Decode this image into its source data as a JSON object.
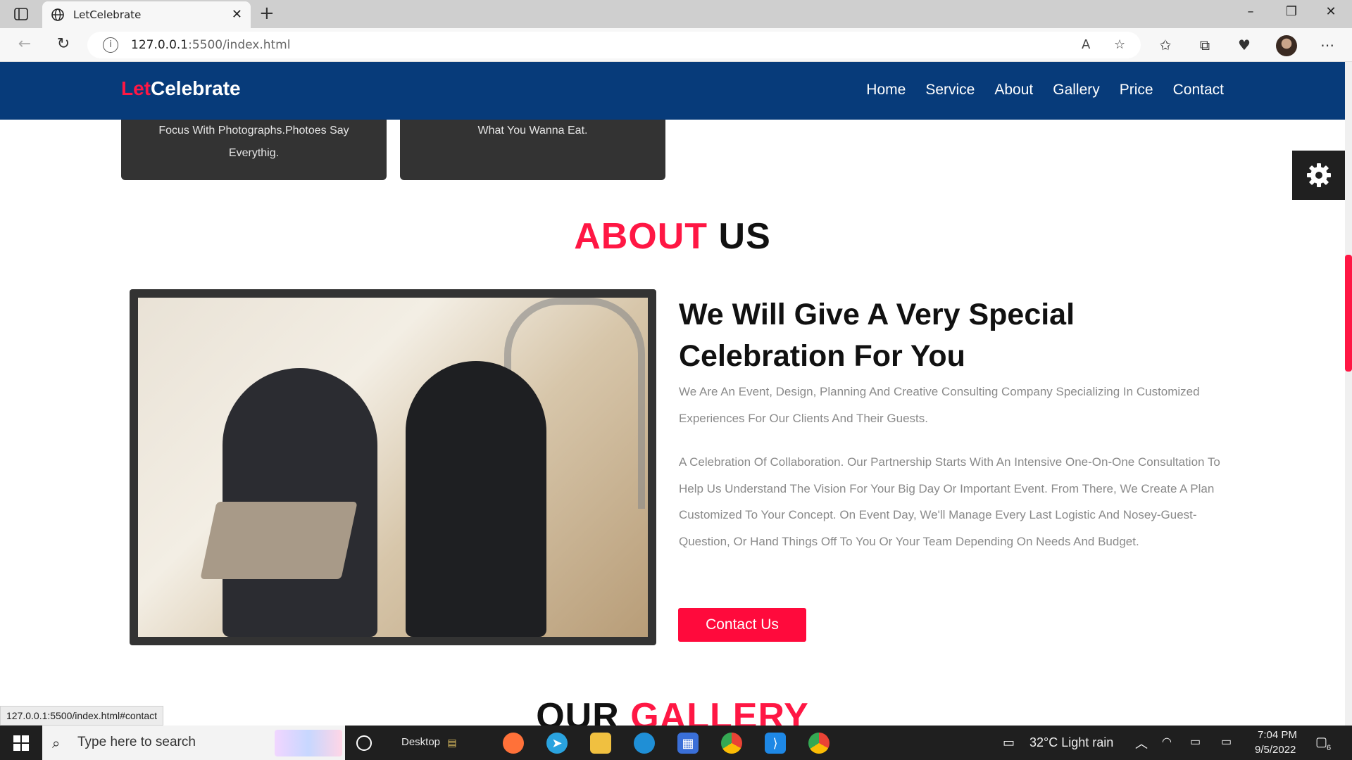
{
  "browser": {
    "tab_title": "LetCelebrate",
    "new_tab": "+",
    "url_host": "127.0.0.1",
    "url_path": ":5500/index.html",
    "window_controls": [
      "–",
      "❐",
      "✕"
    ]
  },
  "site": {
    "logo_part1": "Let",
    "logo_part2": "Celebrate",
    "nav": [
      "Home",
      "Service",
      "About",
      "Gallery",
      "Price",
      "Contact"
    ],
    "cards": [
      {
        "text_line1": "Focus With Photographs.Photoes Say",
        "text_line2": "Everythig."
      },
      {
        "text_line1": "What You Wanna Eat.",
        "text_line2": ""
      }
    ],
    "about": {
      "title_red": "ABOUT",
      "title_dark": "US",
      "headline_line1": "We Will Give A Very Special",
      "headline_line2": "Celebration For You",
      "paragraph1": "We Are An Event, Design, Planning And Creative Consulting Company Specializing In Customized Experiences For Our Clients And Their Guests.",
      "paragraph2": "A Celebration Of Collaboration. Our Partnership Starts With An Intensive One-On-One Consultation To Help Us Understand The Vision For Your Big Day Or Important Event. From There, We Create A Plan Customized To Your Concept. On Event Day, We'll Manage Every Last Logistic And Nosey-Guest-Question, Or Hand Things Off To You Or Your Team Depending On Needs And Budget.",
      "button": "Contact Us"
    },
    "gallery": {
      "title_dark": "OUR",
      "title_red": "GALLERY"
    }
  },
  "status_url": "127.0.0.1:5500/index.html#contact",
  "taskbar": {
    "search_placeholder": "Type here to search",
    "desktop_label": "Desktop",
    "weather": "32°C  Light rain",
    "time": "7:04 PM",
    "date": "9/5/2022",
    "notification_count": "6"
  },
  "colors": {
    "nav_bg": "#073b7a",
    "accent_red": "#ff1744",
    "card_bg": "#333333"
  }
}
